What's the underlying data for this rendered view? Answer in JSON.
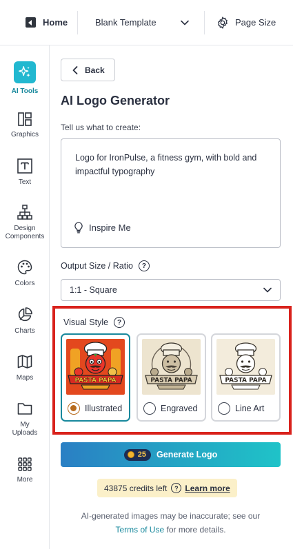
{
  "topbar": {
    "home_label": "Home",
    "template_label": "Blank Template",
    "pagesize_label": "Page Size"
  },
  "sidebar": {
    "items": [
      {
        "label": "AI Tools",
        "icon": "sparkle-icon",
        "active": true
      },
      {
        "label": "Graphics",
        "icon": "graphics-icon"
      },
      {
        "label": "Text",
        "icon": "text-icon"
      },
      {
        "label": "Design Components",
        "icon": "design-components-icon"
      },
      {
        "label": "Colors",
        "icon": "palette-icon"
      },
      {
        "label": "Charts",
        "icon": "pie-chart-icon"
      },
      {
        "label": "Maps",
        "icon": "map-icon"
      },
      {
        "label": "My Uploads",
        "icon": "folder-icon"
      },
      {
        "label": "More",
        "icon": "grid-icon"
      }
    ]
  },
  "main": {
    "back_label": "Back",
    "title": "AI Logo Generator",
    "prompt_label": "Tell us what to create:",
    "prompt_value": "Logo for IronPulse, a fitness gym, with bold and impactful typography",
    "inspire_label": "Inspire Me",
    "size_label": "Output Size / Ratio",
    "size_value": "1:1 - Square",
    "visual_style_label": "Visual Style",
    "styles": [
      {
        "name": "Illustrated",
        "selected": true,
        "thumb_text": "PASTA PAPA"
      },
      {
        "name": "Engraved",
        "selected": false,
        "thumb_text": "PASTA PAPA"
      },
      {
        "name": "Line Art",
        "selected": false,
        "thumb_text": "PASTA PAPA"
      }
    ],
    "generate_credits": "25",
    "generate_label": "Generate Logo",
    "credits_left": "43875 credits left",
    "learn_more": "Learn more",
    "disclaimer_pre": "AI-generated images may be inaccurate; see our",
    "terms_link": "Terms of Use",
    "disclaimer_post": " for more details."
  },
  "colors": {
    "accent": "#17889c",
    "highlight_frame": "#d9221c",
    "selected_radio": "#b76a1c",
    "generate_gradient_start": "#2a7fc4",
    "generate_gradient_end": "#1fc3c8"
  }
}
